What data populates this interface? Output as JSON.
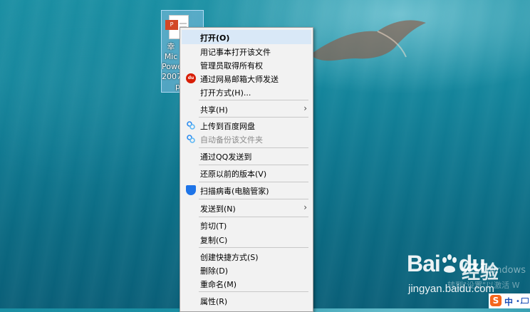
{
  "desktop": {
    "icon_caption": [
      "幸",
      "Mic",
      "Powe",
      "2007",
      "p"
    ],
    "icon_badge": "P"
  },
  "context_menu": {
    "items": [
      {
        "id": "open",
        "label": "打开(O)",
        "bold": true
      },
      {
        "id": "open-notepad",
        "label": "用记事本打开该文件"
      },
      {
        "id": "take-ownership",
        "label": "管理员取得所有权"
      },
      {
        "id": "send-via-mail-master",
        "label": "通过网易邮箱大师发送",
        "icon": "netease-mail-icon"
      },
      {
        "id": "open-with",
        "label": "打开方式(H)..."
      },
      {
        "id": "share",
        "label": "共享(H)",
        "submenu": true
      },
      {
        "id": "upload-baidu",
        "label": "上传到百度网盘",
        "icon": "baidu-netdisk-icon"
      },
      {
        "id": "auto-backup",
        "label": "自动备份该文件夹",
        "icon": "baidu-netdisk-icon",
        "disabled": true
      },
      {
        "id": "send-qq",
        "label": "通过QQ发送到"
      },
      {
        "id": "restore-versions",
        "label": "还原以前的版本(V)"
      },
      {
        "id": "scan-virus",
        "label": "扫描病毒(电脑管家)",
        "icon": "shield-icon"
      },
      {
        "id": "send-to",
        "label": "发送到(N)",
        "submenu": true
      },
      {
        "id": "cut",
        "label": "剪切(T)"
      },
      {
        "id": "copy",
        "label": "复制(C)"
      },
      {
        "id": "create-shortcut",
        "label": "创建快捷方式(S)"
      },
      {
        "id": "delete",
        "label": "删除(D)"
      },
      {
        "id": "rename",
        "label": "重命名(M)"
      },
      {
        "id": "properties",
        "label": "属性(R)"
      }
    ],
    "netease_icon_text": "du"
  },
  "watermark": {
    "brand": "Bai",
    "brand_tail": "du",
    "brand_cn": "经验",
    "url": "jingyan.baidu.com"
  },
  "activation": {
    "line1": "Windows",
    "line2": "转到\"设置\"以激活 W"
  },
  "ime": {
    "logo": "S",
    "mode": "中",
    "punct": "•,"
  },
  "colors": {
    "menu_bg": "#f2f2f2",
    "hover_bg": "#d9e8f7",
    "accent_red": "#d81e06",
    "shield_blue": "#1e74e8",
    "ime_orange": "#f3661c"
  }
}
